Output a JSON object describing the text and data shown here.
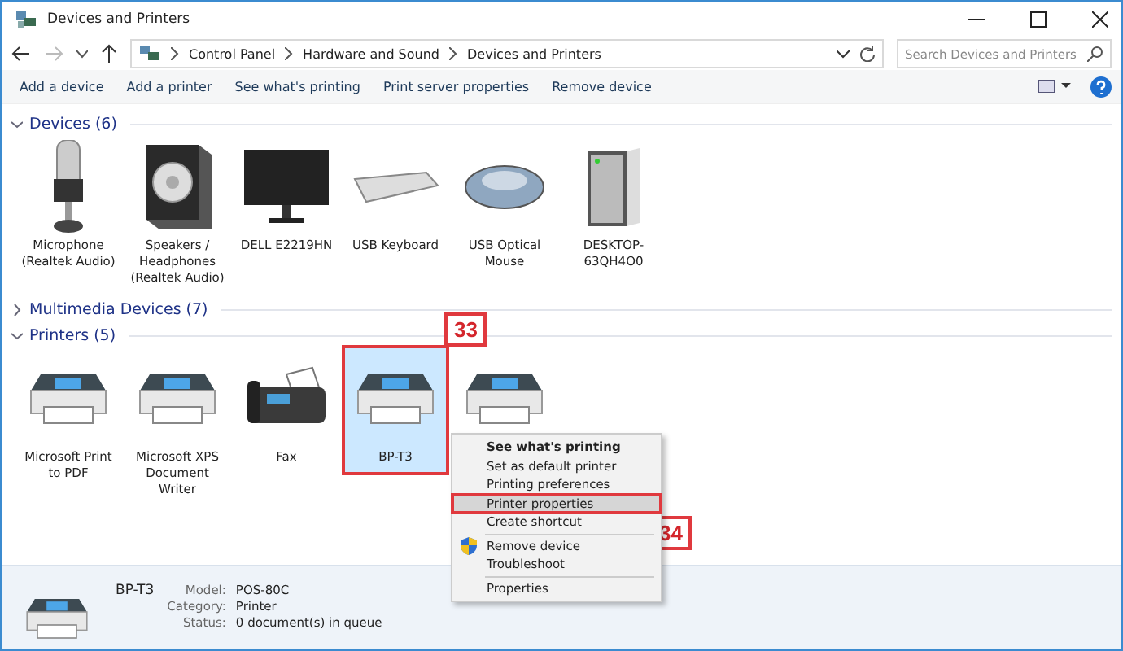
{
  "window": {
    "title": "Devices and Printers"
  },
  "address": {
    "path": [
      "Control Panel",
      "Hardware and Sound",
      "Devices and Printers"
    ],
    "search_placeholder": "Search Devices and Printers"
  },
  "toolbar": [
    "Add a device",
    "Add a printer",
    "See what's printing",
    "Print server properties",
    "Remove device"
  ],
  "groups": [
    {
      "title": "Devices (6)",
      "expanded": true,
      "items": [
        {
          "label": "Microphone (Realtek Audio)",
          "kind": "microphone",
          "selected": false
        },
        {
          "label": "Speakers / Headphones (Realtek Audio)",
          "kind": "speaker",
          "selected": false
        },
        {
          "label": "DELL E2219HN",
          "kind": "monitor",
          "selected": false
        },
        {
          "label": "USB Keyboard",
          "kind": "keyboard",
          "selected": false
        },
        {
          "label": "USB Optical Mouse",
          "kind": "mouse",
          "selected": false
        },
        {
          "label": "DESKTOP-63QH4O0",
          "kind": "computer",
          "selected": false
        }
      ]
    },
    {
      "title": "Multimedia Devices (7)",
      "expanded": false
    },
    {
      "title": "Printers (5)",
      "expanded": true,
      "items": [
        {
          "label": "Microsoft Print to PDF",
          "kind": "printer",
          "selected": false
        },
        {
          "label": "Microsoft XPS Document Writer",
          "kind": "printer",
          "selected": false
        },
        {
          "label": "Fax",
          "kind": "fax",
          "selected": false
        },
        {
          "label": "BP-T3",
          "kind": "printer",
          "selected": true,
          "callout": "33"
        },
        {
          "kind": "printer",
          "selected": false
        }
      ]
    }
  ],
  "context_menu": {
    "items": [
      {
        "kind": "item",
        "label": "See what's printing",
        "default": true,
        "selected": false
      },
      {
        "kind": "item",
        "label": "Set as default printer",
        "default": false,
        "selected": false
      },
      {
        "kind": "item",
        "label": "Printing preferences",
        "default": false,
        "selected": false
      },
      {
        "kind": "item",
        "label": "Printer properties",
        "default": false,
        "selected": true,
        "callout": "34"
      },
      {
        "kind": "item",
        "label": "Create shortcut",
        "default": false,
        "selected": false
      },
      {
        "kind": "separator"
      },
      {
        "kind": "item",
        "label": "Remove device",
        "default": false,
        "selected": false,
        "shield": true
      },
      {
        "kind": "item",
        "label": "Troubleshoot",
        "default": false,
        "selected": false
      },
      {
        "kind": "separator"
      },
      {
        "kind": "item",
        "label": "Properties",
        "default": false,
        "selected": false
      }
    ]
  },
  "details": {
    "name": "BP-T3",
    "fields": [
      {
        "label": "Model:",
        "value": "POS-80C"
      },
      {
        "label": "Category:",
        "value": "Printer"
      },
      {
        "label": "Status:",
        "value": "0 document(s) in queue"
      }
    ]
  }
}
